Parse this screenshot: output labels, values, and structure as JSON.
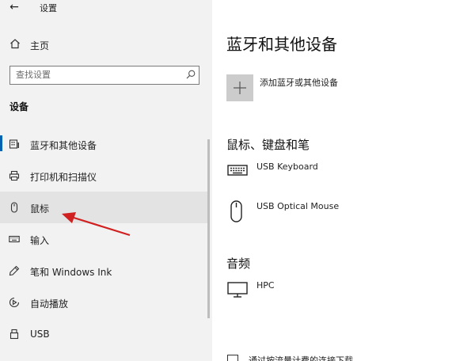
{
  "window": {
    "title": "设置",
    "back_glyph": "←"
  },
  "sidebar": {
    "home_label": "主页",
    "search_placeholder": "查找设置",
    "section_label": "设备",
    "items": [
      {
        "label": "蓝牙和其他设备",
        "icon": "bluetooth-devices-icon",
        "selected": false
      },
      {
        "label": "打印机和扫描仪",
        "icon": "printer-icon",
        "selected": false
      },
      {
        "label": "鼠标",
        "icon": "mouse-icon",
        "selected": true
      },
      {
        "label": "输入",
        "icon": "keyboard-icon",
        "selected": false
      },
      {
        "label": "笔和 Windows Ink",
        "icon": "pen-icon",
        "selected": false
      },
      {
        "label": "自动播放",
        "icon": "autoplay-icon",
        "selected": false
      },
      {
        "label": "USB",
        "icon": "usb-icon",
        "selected": false
      }
    ]
  },
  "main": {
    "title": "蓝牙和其他设备",
    "add_device_label": "添加蓝牙或其他设备",
    "input_section": {
      "label": "鼠标、键盘和笔",
      "devices": [
        {
          "name": "USB Keyboard",
          "icon": "keyboard-icon"
        },
        {
          "name": "USB Optical Mouse",
          "icon": "mouse-icon"
        }
      ]
    },
    "audio_section": {
      "label": "音频",
      "devices": [
        {
          "name": "HPC",
          "icon": "monitor-icon"
        }
      ]
    },
    "metered_checkbox_label": "通过按流量计费的连接下载"
  },
  "colors": {
    "accent": "#0063b1",
    "annotation_arrow": "#d02020",
    "sidebar_bg": "#f2f2f2",
    "selected_bg": "#e3e3e3"
  }
}
